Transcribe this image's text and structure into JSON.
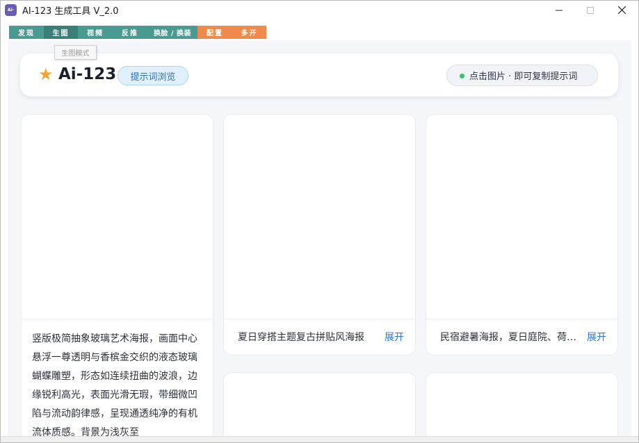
{
  "window": {
    "app_icon_text": "Ai-123",
    "title": "AI-123 生成工具 V_2.0"
  },
  "menu": [
    {
      "label": "发现",
      "color": "teal"
    },
    {
      "label": "生图",
      "color": "active"
    },
    {
      "label": "视频",
      "color": "teal"
    },
    {
      "label": "反推",
      "color": "teal"
    },
    {
      "label": "换脸 / 换装",
      "color": "teal"
    },
    {
      "label": "配置",
      "color": "orange"
    },
    {
      "label": "多开",
      "color": "orange"
    }
  ],
  "tooltip": "生图模式",
  "header": {
    "brand": "Ai-123",
    "browse_pill": "提示词浏览",
    "status": "点击图片 · 即可复制提示词"
  },
  "cards": [
    {
      "caption": "竖版极简抽象玻璃艺术海报，画面中心悬浮一尊透明与香槟金交织的液态玻璃蝴蝶雕塑，形态如连续扭曲的波浪，边缘锐利高光，表面光滑无瑕，带细微凹陷与流动韵律感，呈现通透纯净的有机流体质感。背景为浅灰至"
    },
    {
      "caption": "夏日穿搭主题复古拼贴风海报",
      "expand": "展开"
    },
    {
      "caption": "民宿避暑海报，夏日庭院、荷花池",
      "expand": "展开"
    }
  ],
  "colors": {
    "menu_teal": "#4a9a94",
    "menu_active": "#3a7e79",
    "menu_orange": "#f08a4b",
    "star": "#f4a32a",
    "link": "#2b78d8",
    "status_dot": "#34c36a"
  }
}
